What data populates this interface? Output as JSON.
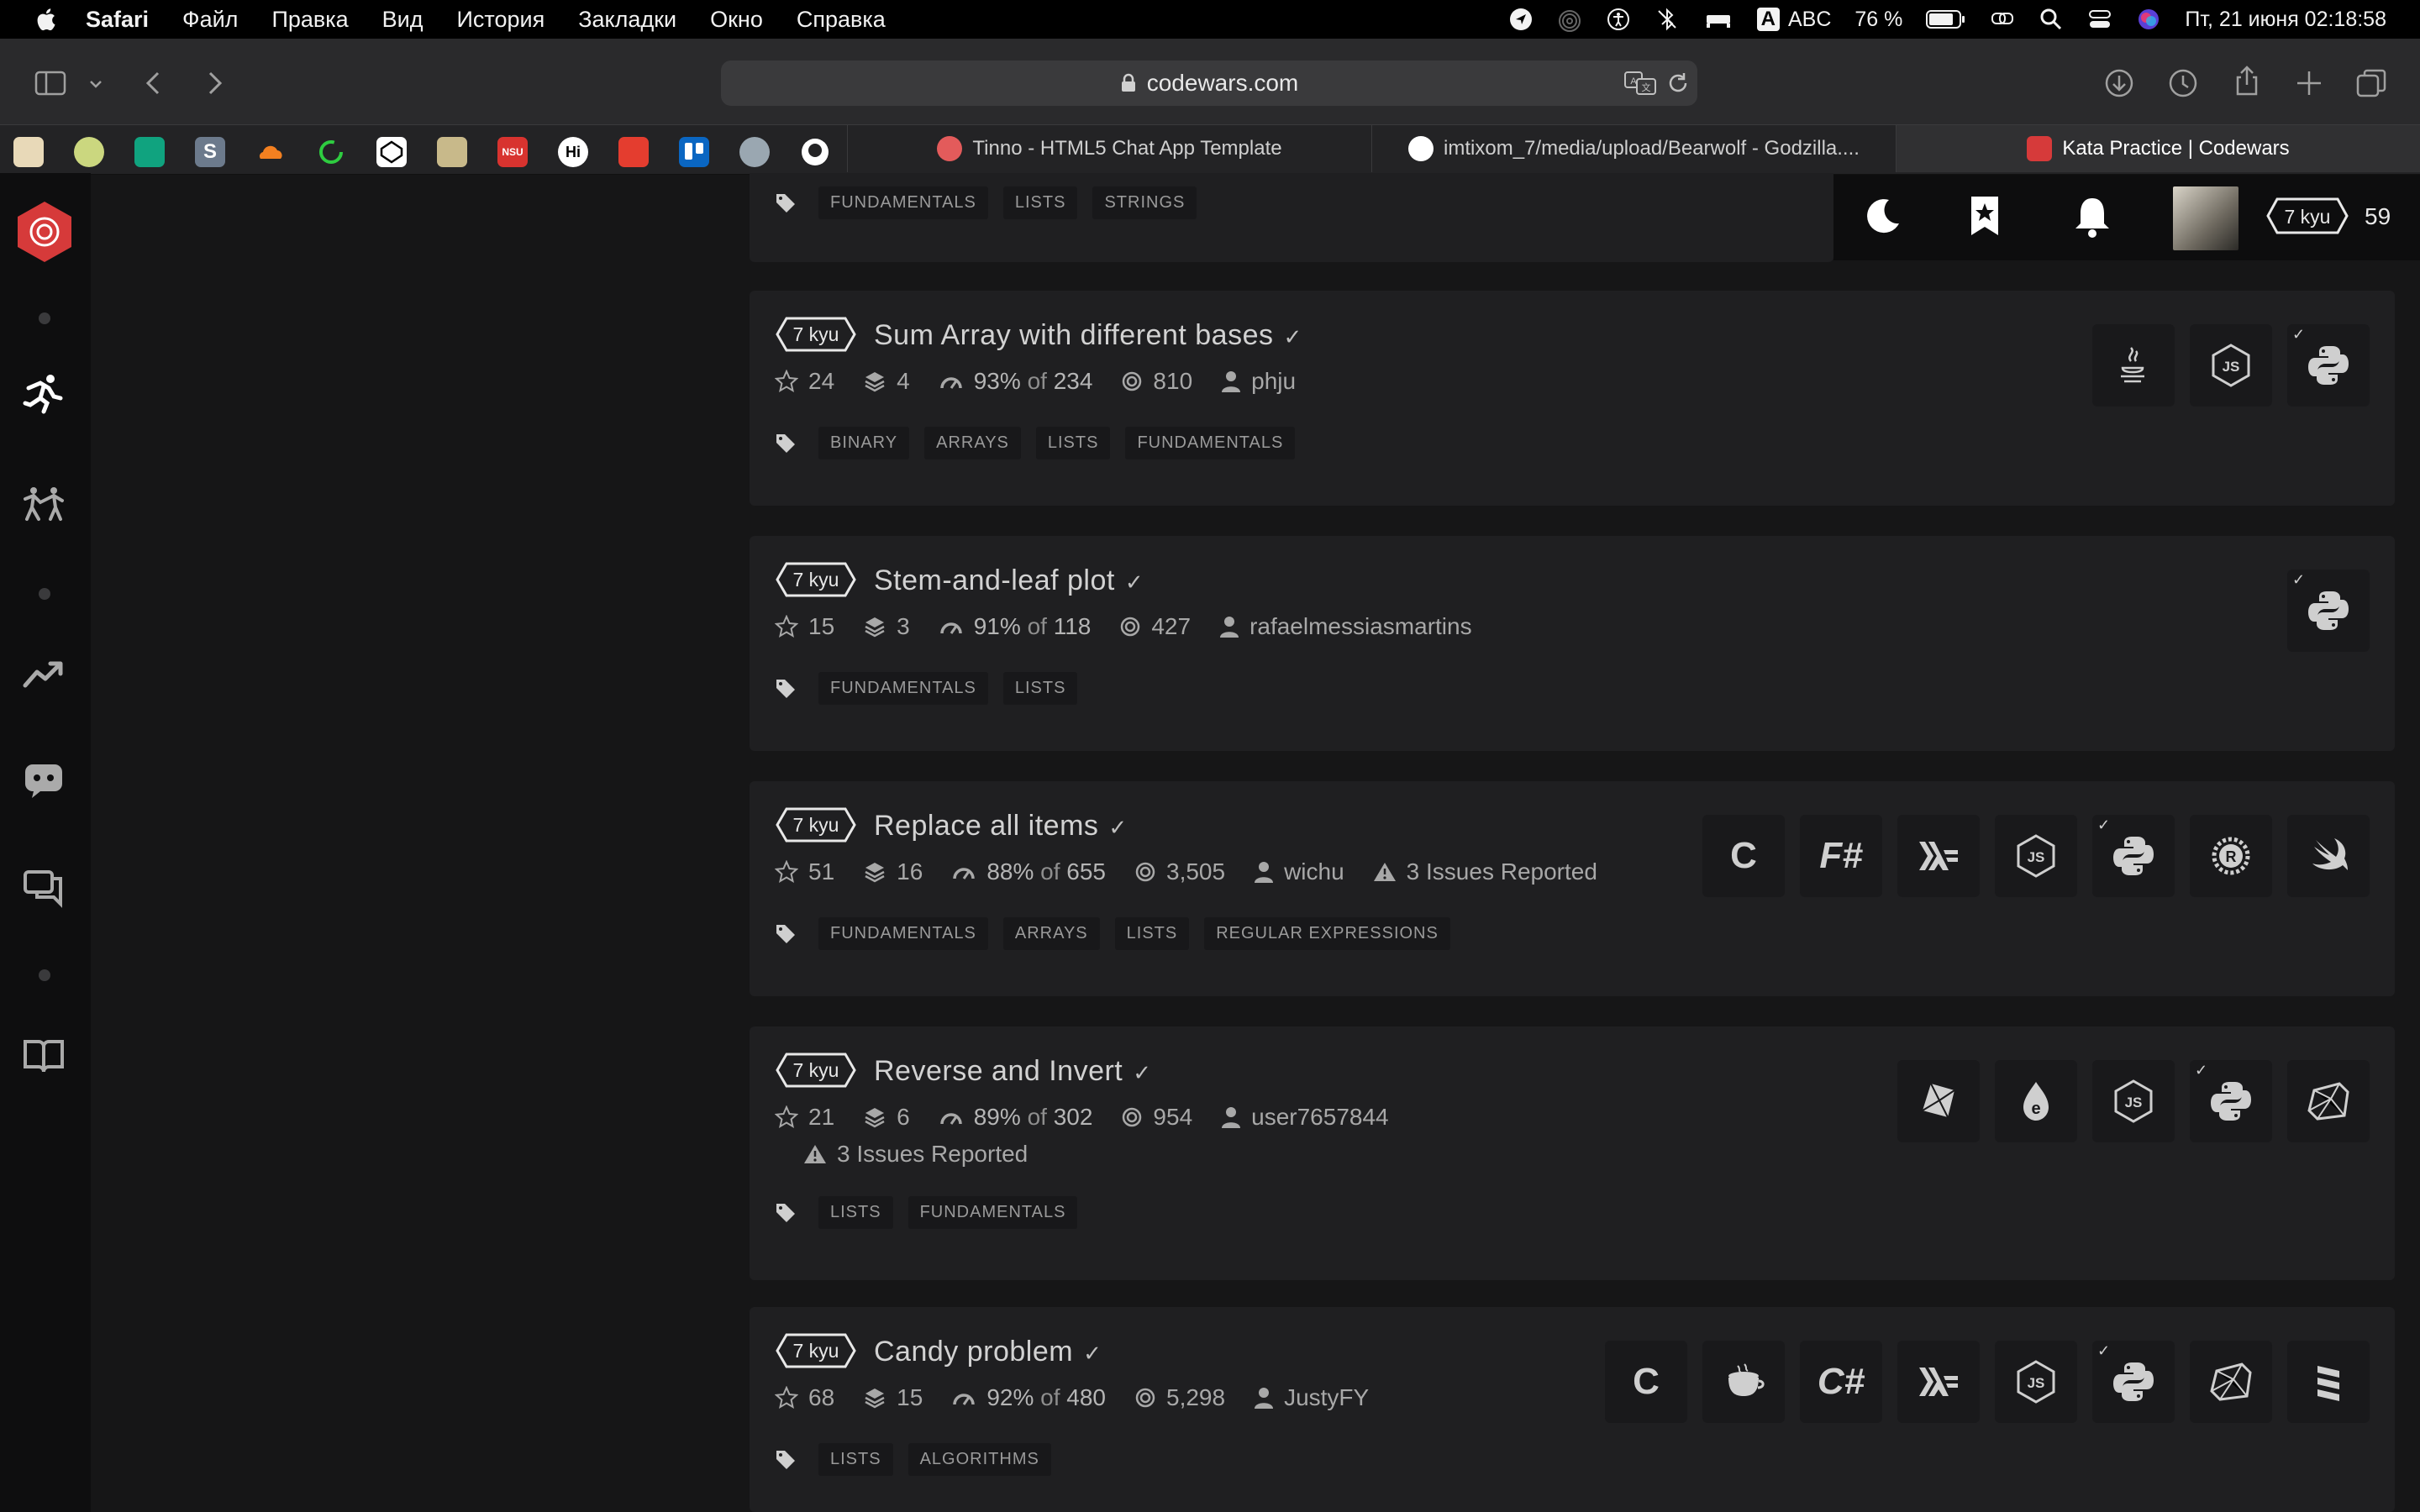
{
  "menubar": {
    "app": "Safari",
    "menus": [
      "Файл",
      "Правка",
      "Вид",
      "История",
      "Закладки",
      "Окно",
      "Справка"
    ],
    "input_source": "ABC",
    "battery": "76 %",
    "datetime": "Пт, 21 июня  02:18:58"
  },
  "toolbar": {
    "url": "codewars.com"
  },
  "tabs": [
    {
      "title": "Tinno - HTML5 Chat App Template"
    },
    {
      "title": "imtixom_7/media/upload/Bearwolf - Godzilla...."
    },
    {
      "title": "Kata Practice | Codewars"
    }
  ],
  "userpanel": {
    "rank": "7 kyu",
    "honor": "59"
  },
  "partial_card": {
    "tags": [
      "FUNDAMENTALS",
      "LISTS",
      "STRINGS"
    ]
  },
  "katas": [
    {
      "rank": "7 kyu",
      "title": "Sum Array with different bases",
      "stars": "24",
      "collections": "4",
      "satisfaction": "93%",
      "of": "of",
      "votes": "234",
      "completed": "810",
      "author": "phju",
      "issues": "",
      "tags": [
        "BINARY",
        "ARRAYS",
        "LISTS",
        "FUNDAMENTALS"
      ],
      "languages": [
        {
          "name": "java-icon",
          "label": "",
          "done": false
        },
        {
          "name": "javascript-icon",
          "label": "",
          "done": false
        },
        {
          "name": "python-icon",
          "label": "",
          "done": true
        }
      ]
    },
    {
      "rank": "7 kyu",
      "title": "Stem-and-leaf plot",
      "stars": "15",
      "collections": "3",
      "satisfaction": "91%",
      "of": "of",
      "votes": "118",
      "completed": "427",
      "author": "rafaelmessiasmartins",
      "issues": "",
      "tags": [
        "FUNDAMENTALS",
        "LISTS"
      ],
      "languages": [
        {
          "name": "python-icon",
          "label": "",
          "done": true
        }
      ]
    },
    {
      "rank": "7 kyu",
      "title": "Replace all items",
      "stars": "51",
      "collections": "16",
      "satisfaction": "88%",
      "of": "of",
      "votes": "655",
      "completed": "3,505",
      "author": "wichu",
      "issues": "3 Issues Reported",
      "tags": [
        "FUNDAMENTALS",
        "ARRAYS",
        "LISTS",
        "REGULAR EXPRESSIONS"
      ],
      "languages": [
        {
          "name": "c-icon",
          "label": "C",
          "done": false
        },
        {
          "name": "fsharp-icon",
          "label": "F#",
          "done": false
        },
        {
          "name": "haskell-icon",
          "label": "",
          "done": false
        },
        {
          "name": "javascript-icon",
          "label": "",
          "done": false
        },
        {
          "name": "python-icon",
          "label": "",
          "done": true
        },
        {
          "name": "rust-icon",
          "label": "",
          "done": false
        },
        {
          "name": "swift-icon",
          "label": "",
          "done": false
        }
      ]
    },
    {
      "rank": "7 kyu",
      "title": "Reverse and Invert",
      "stars": "21",
      "collections": "6",
      "satisfaction": "89%",
      "of": "of",
      "votes": "302",
      "completed": "954",
      "author": "user7657844",
      "issues": "3 Issues Reported",
      "tags": [
        "LISTS",
        "FUNDAMENTALS"
      ],
      "languages": [
        {
          "name": "crystal-icon",
          "label": "",
          "done": false
        },
        {
          "name": "elixir-icon",
          "label": "",
          "done": false
        },
        {
          "name": "javascript-icon",
          "label": "",
          "done": false
        },
        {
          "name": "python-icon",
          "label": "",
          "done": true
        },
        {
          "name": "ruby-icon",
          "label": "",
          "done": false
        }
      ]
    },
    {
      "rank": "7 kyu",
      "title": "Candy problem",
      "stars": "68",
      "collections": "15",
      "satisfaction": "92%",
      "of": "of",
      "votes": "480",
      "completed": "5,298",
      "author": "JustyFY",
      "issues": "",
      "tags": [
        "LISTS",
        "ALGORITHMS"
      ],
      "languages": [
        {
          "name": "c-icon",
          "label": "C",
          "done": false
        },
        {
          "name": "coffeescript-icon",
          "label": "",
          "done": false
        },
        {
          "name": "csharp-icon",
          "label": "C#",
          "done": false
        },
        {
          "name": "haskell-icon",
          "label": "",
          "done": false
        },
        {
          "name": "javascript-icon",
          "label": "",
          "done": false
        },
        {
          "name": "python-icon",
          "label": "",
          "done": true
        },
        {
          "name": "ruby-icon",
          "label": "",
          "done": false
        },
        {
          "name": "scala-icon",
          "label": "",
          "done": false
        }
      ]
    }
  ]
}
